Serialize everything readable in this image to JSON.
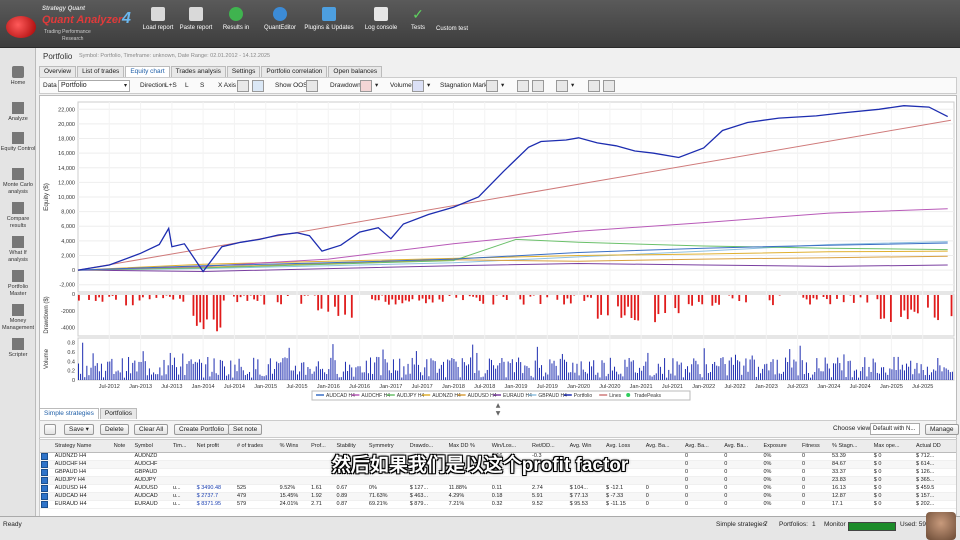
{
  "app": {
    "logo_top": "Strategy Quant",
    "logo_name": "Quant Analyzer",
    "logo_version": "4",
    "logo_tag1": "Trading Performance",
    "logo_tag2": "Research"
  },
  "toolbar": [
    {
      "label": "Load report",
      "icon": "folder-icon"
    },
    {
      "label": "Paste report",
      "icon": "clipboard-icon"
    },
    {
      "label": "Results in",
      "icon": "import-icon"
    },
    {
      "label": "QuantEditor",
      "icon": "editor-icon"
    },
    {
      "label": "Plugins & Updates",
      "icon": "plugin-icon"
    },
    {
      "label": "Log console",
      "icon": "console-icon"
    },
    {
      "label": "Tests",
      "icon": "check-icon"
    },
    {
      "label": "Custom test",
      "icon": ""
    }
  ],
  "sidebar": [
    {
      "label": "Home"
    },
    {
      "label": "Analyze"
    },
    {
      "label": "Equity Control"
    },
    {
      "label": "Monte Carlo analysis"
    },
    {
      "label": "Compare results"
    },
    {
      "label": "What If analysis"
    },
    {
      "label": "Portfolio Master"
    },
    {
      "label": "Money Management"
    },
    {
      "label": "Scripter"
    }
  ],
  "portfolio": {
    "title": "Portfolio",
    "subtitle": "Symbol: Portfolio, Timeframe: unknown, Date Range: 02.01.2012 - 14.12.2025"
  },
  "tabs": [
    "Overview",
    "List of trades",
    "Equity chart",
    "Trades analysis",
    "Settings",
    "Portfolio correlation",
    "Open balances"
  ],
  "active_tab": 2,
  "chart_toolbar": {
    "data_label": "Data",
    "data_value": "Portfolio",
    "direction_label": "Direction",
    "direction_opts": [
      "L+S",
      "L",
      "S"
    ],
    "xaxis_label": "X Axis",
    "show_oos_label": "Show OOS",
    "drawdown_label": "Drawdown",
    "volume_label": "Volume",
    "stagnation_label": "Stagnation Marker"
  },
  "chart_data": {
    "type": "line",
    "ylabel": "Equity ($)",
    "yticks": [
      "22,000",
      "20,000",
      "18,000",
      "16,000",
      "14,000",
      "12,000",
      "10,000",
      "8,000",
      "6,000",
      "4,000",
      "2,000",
      "0",
      "-2,000"
    ],
    "ylim": [
      -3000,
      23000
    ],
    "xticks": [
      "Jul-2012",
      "Jan-2013",
      "Jul-2013",
      "Jan-2014",
      "Jul-2014",
      "Jan-2015",
      "Jul-2015",
      "Jan-2016",
      "Jul-2016",
      "Jan-2017",
      "Jul-2017",
      "Jan-2018",
      "Jul-2018",
      "Jan-2019",
      "Jul-2019",
      "Jan-2020",
      "Jul-2020",
      "Jan-2021",
      "Jul-2021",
      "Jan-2022",
      "Jul-2022",
      "Jan-2023",
      "Jul-2023",
      "Jan-2024",
      "Jul-2024",
      "Jan-2025",
      "Jul-2025"
    ],
    "xlim": [
      2012.0,
      2026.0
    ],
    "series": [
      {
        "name": "Portfolio",
        "color": "#1d2db0",
        "points": [
          [
            2012.0,
            0
          ],
          [
            2012.5,
            700
          ],
          [
            2013.0,
            2300
          ],
          [
            2013.3,
            3500
          ],
          [
            2013.45,
            5700
          ],
          [
            2013.5,
            3200
          ],
          [
            2013.7,
            3600
          ],
          [
            2014.0,
            -200
          ],
          [
            2014.3,
            3200
          ],
          [
            2014.6,
            3800
          ],
          [
            2014.9,
            4200
          ],
          [
            2015.2,
            4800
          ],
          [
            2015.5,
            5100
          ],
          [
            2015.7,
            4700
          ],
          [
            2015.9,
            2600
          ],
          [
            2016.2,
            3400
          ],
          [
            2016.5,
            5200
          ],
          [
            2016.8,
            5800
          ],
          [
            2017.0,
            4300
          ],
          [
            2017.2,
            6300
          ],
          [
            2017.6,
            7600
          ],
          [
            2018.0,
            8600
          ],
          [
            2018.4,
            10000
          ],
          [
            2018.8,
            13500
          ],
          [
            2019.2,
            16800
          ],
          [
            2019.4,
            17600
          ],
          [
            2019.8,
            17800
          ],
          [
            2020.0,
            18100
          ],
          [
            2020.3,
            17400
          ],
          [
            2020.6,
            17000
          ],
          [
            2020.9,
            16300
          ],
          [
            2021.2,
            16000
          ],
          [
            2021.6,
            15400
          ],
          [
            2022.0,
            16700
          ],
          [
            2022.3,
            19100
          ],
          [
            2022.7,
            20200
          ],
          [
            2023.2,
            20800
          ],
          [
            2023.8,
            21100
          ],
          [
            2024.2,
            21500
          ],
          [
            2024.8,
            22000
          ],
          [
            2025.2,
            22500
          ],
          [
            2025.6,
            22300
          ],
          [
            2025.9,
            21000
          ]
        ]
      },
      {
        "name": "Lines",
        "color": "#cf7a7a",
        "points": [
          [
            2012.0,
            0
          ],
          [
            2025.95,
            20500
          ]
        ]
      },
      {
        "name": "AUDCAD H4",
        "color": "#3a6fc4",
        "points": [
          [
            2012.0,
            0
          ],
          [
            2014.0,
            600
          ],
          [
            2016.0,
            1000
          ],
          [
            2018.0,
            1500
          ],
          [
            2020.0,
            2400
          ],
          [
            2022.0,
            3000
          ],
          [
            2024.0,
            3400
          ],
          [
            2025.9,
            3700
          ]
        ]
      },
      {
        "name": "AUDCHF H4",
        "color": "#b85ab8",
        "points": [
          [
            2012.0,
            0
          ],
          [
            2014.0,
            500
          ],
          [
            2016.0,
            1500
          ],
          [
            2018.0,
            3600
          ],
          [
            2020.0,
            5300
          ],
          [
            2022.0,
            6500
          ],
          [
            2024.0,
            7800
          ],
          [
            2025.9,
            8400
          ]
        ]
      },
      {
        "name": "AUDJPY H4",
        "color": "#6bc06b",
        "points": [
          [
            2012.0,
            0
          ],
          [
            2014.0,
            300
          ],
          [
            2016.0,
            800
          ],
          [
            2018.0,
            1300
          ],
          [
            2019.0,
            4200
          ],
          [
            2020.0,
            3800
          ],
          [
            2022.0,
            3300
          ],
          [
            2024.0,
            3000
          ],
          [
            2025.9,
            2800
          ]
        ]
      },
      {
        "name": "AUDNZD H4",
        "color": "#e0b030",
        "points": [
          [
            2012.0,
            0
          ],
          [
            2014.0,
            800
          ],
          [
            2016.0,
            1200
          ],
          [
            2018.0,
            1600
          ],
          [
            2020.0,
            2000
          ],
          [
            2022.0,
            2200
          ],
          [
            2024.0,
            2500
          ],
          [
            2025.9,
            2600
          ]
        ]
      },
      {
        "name": "AUDUSD H4",
        "color": "#d9a040",
        "points": [
          [
            2012.0,
            0
          ],
          [
            2014.0,
            400
          ],
          [
            2016.0,
            900
          ],
          [
            2018.0,
            1400
          ],
          [
            2020.0,
            1200
          ],
          [
            2022.0,
            1500
          ],
          [
            2024.0,
            1700
          ],
          [
            2025.9,
            1900
          ]
        ]
      },
      {
        "name": "EURAUD H4",
        "color": "#7a3fa0",
        "points": [
          [
            2012.0,
            0
          ],
          [
            2014.0,
            -200
          ],
          [
            2016.0,
            200
          ],
          [
            2018.0,
            600
          ],
          [
            2020.0,
            900
          ],
          [
            2022.0,
            700
          ],
          [
            2024.0,
            500
          ],
          [
            2025.9,
            700
          ]
        ]
      },
      {
        "name": "GBPAUD H4",
        "color": "#8fc0e0",
        "points": [
          [
            2012.0,
            0
          ],
          [
            2014.0,
            200
          ],
          [
            2016.0,
            600
          ],
          [
            2018.0,
            1000
          ],
          [
            2020.0,
            1800
          ],
          [
            2022.0,
            2600
          ],
          [
            2024.0,
            3500
          ],
          [
            2025.9,
            3900
          ]
        ]
      }
    ],
    "drawdown_label": "Drawdown ($)",
    "drawdown_ticks": [
      "0",
      "-2000",
      "-4000"
    ],
    "drawdown_ylim": [
      -5000,
      0
    ],
    "volume_label": "Volume",
    "volume_ticks": [
      "0.8",
      "0.6",
      "0.4",
      "0.2",
      "0"
    ],
    "volume_ylim": [
      0,
      0.9
    ],
    "legend": [
      "AUDCAD H4",
      "AUDCHF H4",
      "AUDJPY H4",
      "AUDNZD H4",
      "AUDUSD H4",
      "EURAUD H4",
      "GBPAUD H4",
      "Portfolio",
      "Lines",
      "TradePeaks"
    ],
    "legend_position": "bottom"
  },
  "bottom_tabs": [
    "Simple strategies",
    "Portfolios"
  ],
  "strategy_toolbar": {
    "save": "Save",
    "delete": "Delete",
    "clear_all": "Clear All",
    "create_portfolio": "Create Portfolio",
    "set_note": "Set note",
    "choose_view_label": "Choose view",
    "choose_view_value": "Default with N...",
    "manage": "Manage"
  },
  "table": {
    "headers": [
      "",
      "Strategy Name",
      "Note",
      "Symbol",
      "Tim...",
      "Net profit",
      "# of trades",
      "% Wins",
      "Prof...",
      "Stability",
      "Symmetry",
      "Drawdo...",
      "Max DD %",
      "Win/Los...",
      "Ret/DD...",
      "Avg. Win",
      "Avg. Loss",
      "Avg. Ba...",
      "Avg. Ba...",
      "Avg. Ba...",
      "Exposure",
      "Fitness",
      "% Stagn...",
      "Max ope...",
      "Actual DD"
    ],
    "rows": [
      [
        "",
        "AUDNZD H4",
        "",
        "AUDNZD",
        "",
        "",
        "",
        "",
        "",
        "",
        "",
        "",
        "",
        "0.16",
        "-0.3",
        "",
        "",
        "",
        "0",
        "0",
        "0%",
        "0",
        "53.39",
        "$ 0",
        "$ 712..."
      ],
      [
        "",
        "AUDCHF H4",
        "",
        "AUDCHF",
        "",
        "",
        "",
        "",
        "",
        "",
        "",
        "",
        "",
        "",
        "",
        "",
        "",
        "",
        "0",
        "0",
        "0%",
        "0",
        "84.67",
        "$ 0",
        "$ 614..."
      ],
      [
        "",
        "GBPAUD H4",
        "",
        "GBPAUD",
        "",
        "",
        "",
        "",
        "",
        "",
        "",
        "",
        "",
        "",
        "",
        "",
        "",
        "",
        "0",
        "0",
        "0%",
        "0",
        "33.37",
        "$ 0",
        "$ 126..."
      ],
      [
        "",
        "AUDJPY H4",
        "",
        "AUDJPY",
        "",
        "",
        "",
        "",
        "",
        "",
        "",
        "",
        "",
        "",
        "",
        "",
        "",
        "",
        "0",
        "0",
        "0%",
        "0",
        "23.83",
        "$ 0",
        "$ 365..."
      ],
      [
        "",
        "AUDUSD H4",
        "",
        "AUDUSD",
        "u...",
        "$ 3490.48",
        "525",
        "9.52%",
        "1.61",
        "0.67",
        "0%",
        "$ 127...",
        "11.88%",
        "0.11",
        "2.74",
        "$ 104...",
        "$ -12.1",
        "0",
        "0",
        "0",
        "0%",
        "0",
        "16.13",
        "$ 0",
        "$ 459.5"
      ],
      [
        "",
        "AUDCAD H4",
        "",
        "AUDCAD",
        "u...",
        "$ 2737.7",
        "479",
        "15.45%",
        "1.92",
        "0.89",
        "71.63%",
        "$ 463...",
        "4.29%",
        "0.18",
        "5.91",
        "$ 77.13",
        "$ -7.33",
        "0",
        "0",
        "0",
        "0%",
        "0",
        "12.87",
        "$ 0",
        "$ 157..."
      ],
      [
        "",
        "EURAUD H4",
        "",
        "EURAUD",
        "u...",
        "$ 8371.95",
        "579",
        "24.01%",
        "2.71",
        "0.87",
        "69.21%",
        "$ 879...",
        "7.21%",
        "0.32",
        "9.52",
        "$ 95.53",
        "$ -11.15",
        "0",
        "0",
        "0",
        "0%",
        "0",
        "17.1",
        "$ 0",
        "$ 202..."
      ]
    ]
  },
  "status": {
    "left": "Ready",
    "simple_label": "Simple strategies:",
    "simple_count": "7",
    "portfolios_label": "Portfolios:",
    "portfolios_count": "1",
    "monitor_label": "Monitor",
    "used_label": "Used: 5935.6"
  },
  "subtitle": "然后如果我们是以这个profit factor"
}
